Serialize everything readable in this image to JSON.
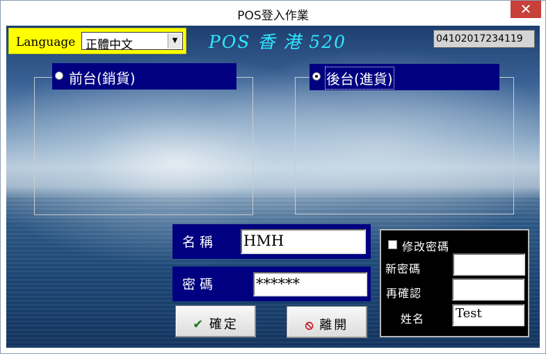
{
  "window": {
    "title": "POS登入作業",
    "close_glyph": "✕"
  },
  "language": {
    "label": "Language",
    "selected": "正體中文",
    "dropdown_glyph": "▼"
  },
  "banner": {
    "text": "POS 香  港  520"
  },
  "serial": {
    "value": "04102017234119"
  },
  "mode": {
    "front": {
      "label": "前台(銷貨)",
      "selected": false
    },
    "back": {
      "label": "後台(進貨)",
      "selected": true
    }
  },
  "login": {
    "name_label": "名稱",
    "name_value": "HMH",
    "password_label": "密碼",
    "password_value": "******"
  },
  "buttons": {
    "confirm": {
      "icon": "check-icon",
      "glyph": "✔",
      "label": "確定"
    },
    "exit": {
      "icon": "no-entry-icon",
      "glyph": "⦸",
      "label": "離開"
    }
  },
  "change_password": {
    "checkbox_label": "修改密碼",
    "checked": false,
    "new_label": "新密碼",
    "new_value": "",
    "confirm_label": "再確認",
    "confirm_value": "",
    "name_label": "姓名",
    "name_value": "Test"
  },
  "colors": {
    "panel_blue": "#000080",
    "language_yellow": "#ffff00",
    "banner_cyan": "#33e6ff",
    "close_red": "#c7403a"
  }
}
